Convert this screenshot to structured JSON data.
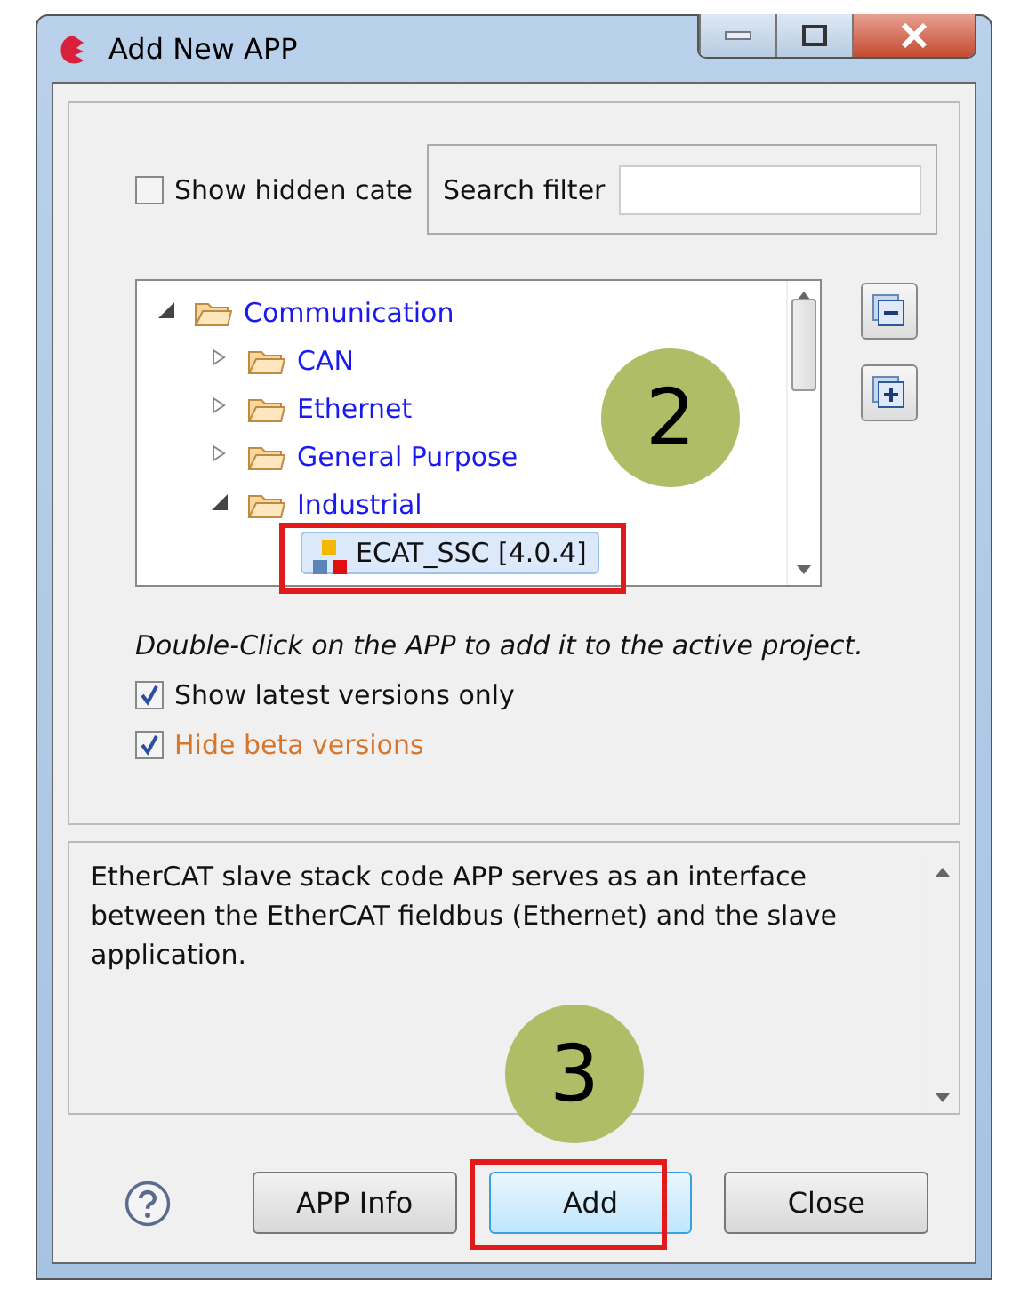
{
  "window": {
    "title": "Add New APP"
  },
  "show_hidden": {
    "label": "Show hidden cate",
    "checked": false
  },
  "search": {
    "label": "Search filter"
  },
  "tree": [
    {
      "label": "Communication",
      "kind": "folder",
      "expanded": true,
      "selected": false,
      "children": [
        {
          "label": "CAN",
          "kind": "folder",
          "expanded": false,
          "selected": false
        },
        {
          "label": "Ethernet",
          "kind": "folder",
          "expanded": false,
          "selected": false
        },
        {
          "label": "General Purpose",
          "kind": "folder",
          "expanded": false,
          "selected": false
        },
        {
          "label": "Industrial",
          "kind": "folder",
          "expanded": true,
          "selected": false,
          "children": [
            {
              "label": "ECAT_SSC [4.0.4]",
              "kind": "app",
              "selected": true
            }
          ]
        }
      ]
    }
  ],
  "hint": "Double-Click on the APP to add it to the active project.",
  "options": [
    {
      "label": "Show latest versions only",
      "checked": true,
      "kind": "normal"
    },
    {
      "label": "Hide beta versions",
      "checked": true,
      "kind": "warning"
    }
  ],
  "description": "EtherCAT slave stack code APP serves as an interface between the EtherCAT fieldbus (Ethernet) and the slave application.",
  "buttons": [
    {
      "label": "APP Info",
      "default": false
    },
    {
      "label": "Add",
      "default": true
    },
    {
      "label": "Close",
      "default": false
    }
  ],
  "annotations": [
    {
      "label": "2"
    },
    {
      "label": "3"
    }
  ]
}
